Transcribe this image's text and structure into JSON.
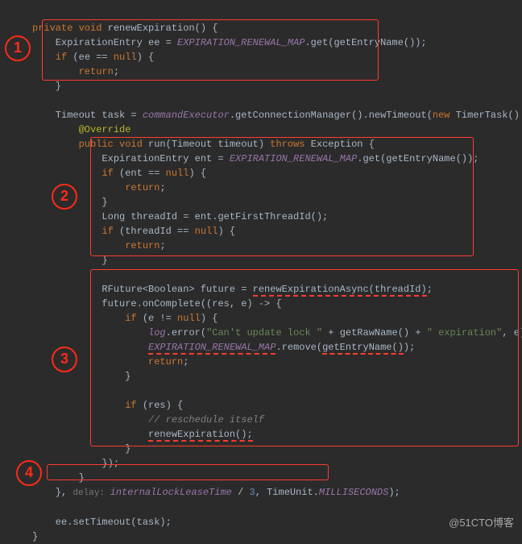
{
  "code": {
    "l1_a": "private void ",
    "l1_b": "renewExpiration",
    "l1_c": "() {",
    "l2_a": "    ExpirationEntry ee = ",
    "l2_b": "EXPIRATION_RENEWAL_MAP",
    "l2_c": ".get(getEntryName());",
    "l3_a": "    if ",
    "l3_b": "(ee == ",
    "l3_c": "null",
    "l3_d": ") {",
    "l4_a": "        return",
    "l4_b": ";",
    "l5": "    }",
    "l6": "",
    "l7_a": "    Timeout task = ",
    "l7_b": "commandExecutor",
    "l7_c": ".getConnectionManager().newTimeout(",
    "l7_d": "new ",
    "l7_e": "TimerTask() {",
    "l8": "        @Override",
    "l9_a": "        public void ",
    "l9_b": "run",
    "l9_c": "(Timeout timeout) ",
    "l9_d": "throws ",
    "l9_e": "Exception {",
    "l10_a": "            ExpirationEntry ent = ",
    "l10_b": "EXPIRATION_RENEWAL_MAP",
    "l10_c": ".get(getEntryName());",
    "l11_a": "            if ",
    "l11_b": "(ent == ",
    "l11_c": "null",
    "l11_d": ") {",
    "l12_a": "                return",
    "l12_b": ";",
    "l13": "            }",
    "l14": "            Long threadId = ent.getFirstThreadId();",
    "l15_a": "            if ",
    "l15_b": "(threadId == ",
    "l15_c": "null",
    "l15_d": ") {",
    "l16_a": "                return",
    "l16_b": ";",
    "l17": "            }",
    "l18": "",
    "l19_a": "            RFuture<Boolean> future = ",
    "l19_b": "renewExpirationAsync(threadId)",
    "l19_c": ";",
    "l20": "            future.onComplete((res, e) -> {",
    "l21_a": "                if ",
    "l21_b": "(e != ",
    "l21_c": "null",
    "l21_d": ") {",
    "l22_a": "                    ",
    "l22_b": "log",
    "l22_c": ".error(",
    "l22_d": "\"Can't update lock \"",
    "l22_e": " + getRawName() + ",
    "l22_f": "\" expiration\"",
    "l22_g": ", e);",
    "l23_a": "                    ",
    "l23_b": "EXPIRATION_RENEWAL_MAP",
    "l23_c": ".remove(",
    "l23_d": "getEntryName()",
    "l23_e": ");",
    "l24_a": "                    return",
    "l24_b": ";",
    "l25": "                }",
    "l26": "",
    "l27_a": "                if ",
    "l27_b": "(res) {",
    "l28": "                    // reschedule itself",
    "l29_a": "                    ",
    "l29_b": "renewExpiration();",
    "l30": "                }",
    "l31": "            });",
    "l32": "        }",
    "l33_a": "    }, ",
    "l33_b": "delay: ",
    "l33_c": "internalLockLeaseTime",
    "l33_d": " / ",
    "l33_e": "3",
    "l33_f": ", TimeUnit.",
    "l33_g": "MILLISECONDS",
    "l33_h": ");",
    "l34": "",
    "l35": "    ee.setTimeout(task);",
    "l36": "}"
  },
  "badges": {
    "b1": "1",
    "b2": "2",
    "b3": "3",
    "b4": "4"
  },
  "watermark": "@51CTO博客"
}
